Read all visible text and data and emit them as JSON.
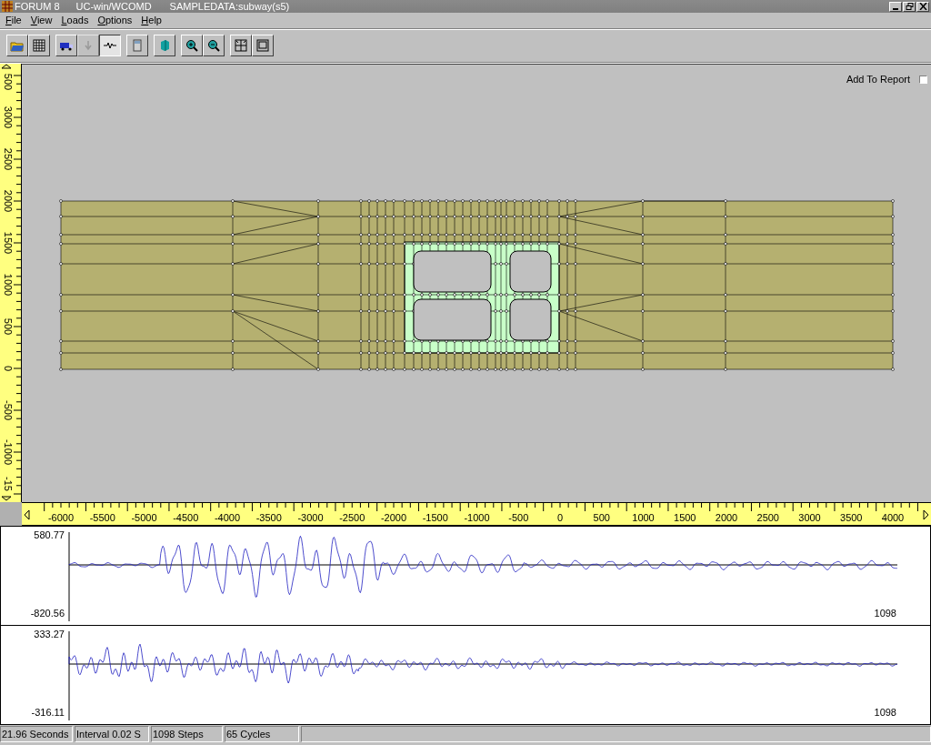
{
  "window": {
    "title_parts": [
      "FORUM 8",
      "UC-win/WCOMD",
      "SAMPLEDATA:subway(s5)"
    ]
  },
  "menu": [
    "File",
    "View",
    "Loads",
    "Options",
    "Help"
  ],
  "toolbar": {
    "groups": [
      [
        {
          "selected": false,
          "disabled": false
        },
        {
          "selected": false,
          "disabled": false
        }
      ],
      [
        {
          "selected": false,
          "disabled": false
        },
        {
          "selected": false,
          "disabled": true
        },
        {
          "selected": true,
          "disabled": false
        }
      ],
      [
        {
          "selected": false,
          "disabled": false
        }
      ],
      [
        {
          "selected": false,
          "disabled": false
        }
      ],
      [
        {
          "selected": false,
          "disabled": false
        },
        {
          "selected": false,
          "disabled": false
        }
      ],
      [
        {
          "selected": false,
          "disabled": false
        },
        {
          "selected": false,
          "disabled": false
        }
      ]
    ]
  },
  "canvas": {
    "add_to_report": {
      "label": "Add To Report",
      "checked": false
    }
  },
  "vertical_ruler": {
    "labels": [
      "500",
      "3000",
      "2500",
      "2000",
      "1500",
      "1000",
      "500",
      "0",
      "-500",
      "-1000",
      "-15"
    ]
  },
  "horizontal_ruler": {
    "labels": [
      "-6000",
      "-5500",
      "-5000",
      "-4500",
      "-4000",
      "-3500",
      "-3000",
      "-2500",
      "-2000",
      "-1500",
      "-1000",
      "-500",
      "0",
      "500",
      "1000",
      "1500",
      "2000",
      "2500",
      "3000",
      "3500",
      "4000"
    ]
  },
  "waveforms": [
    {
      "max": "580.77",
      "min": "-820.56",
      "steps": "1098"
    },
    {
      "max": "333.27",
      "min": "-316.11",
      "steps": "1098"
    }
  ],
  "status_bar": [
    "21.96 Seconds",
    "Interval 0.02 S",
    "1098 Steps",
    "65 Cycles"
  ]
}
